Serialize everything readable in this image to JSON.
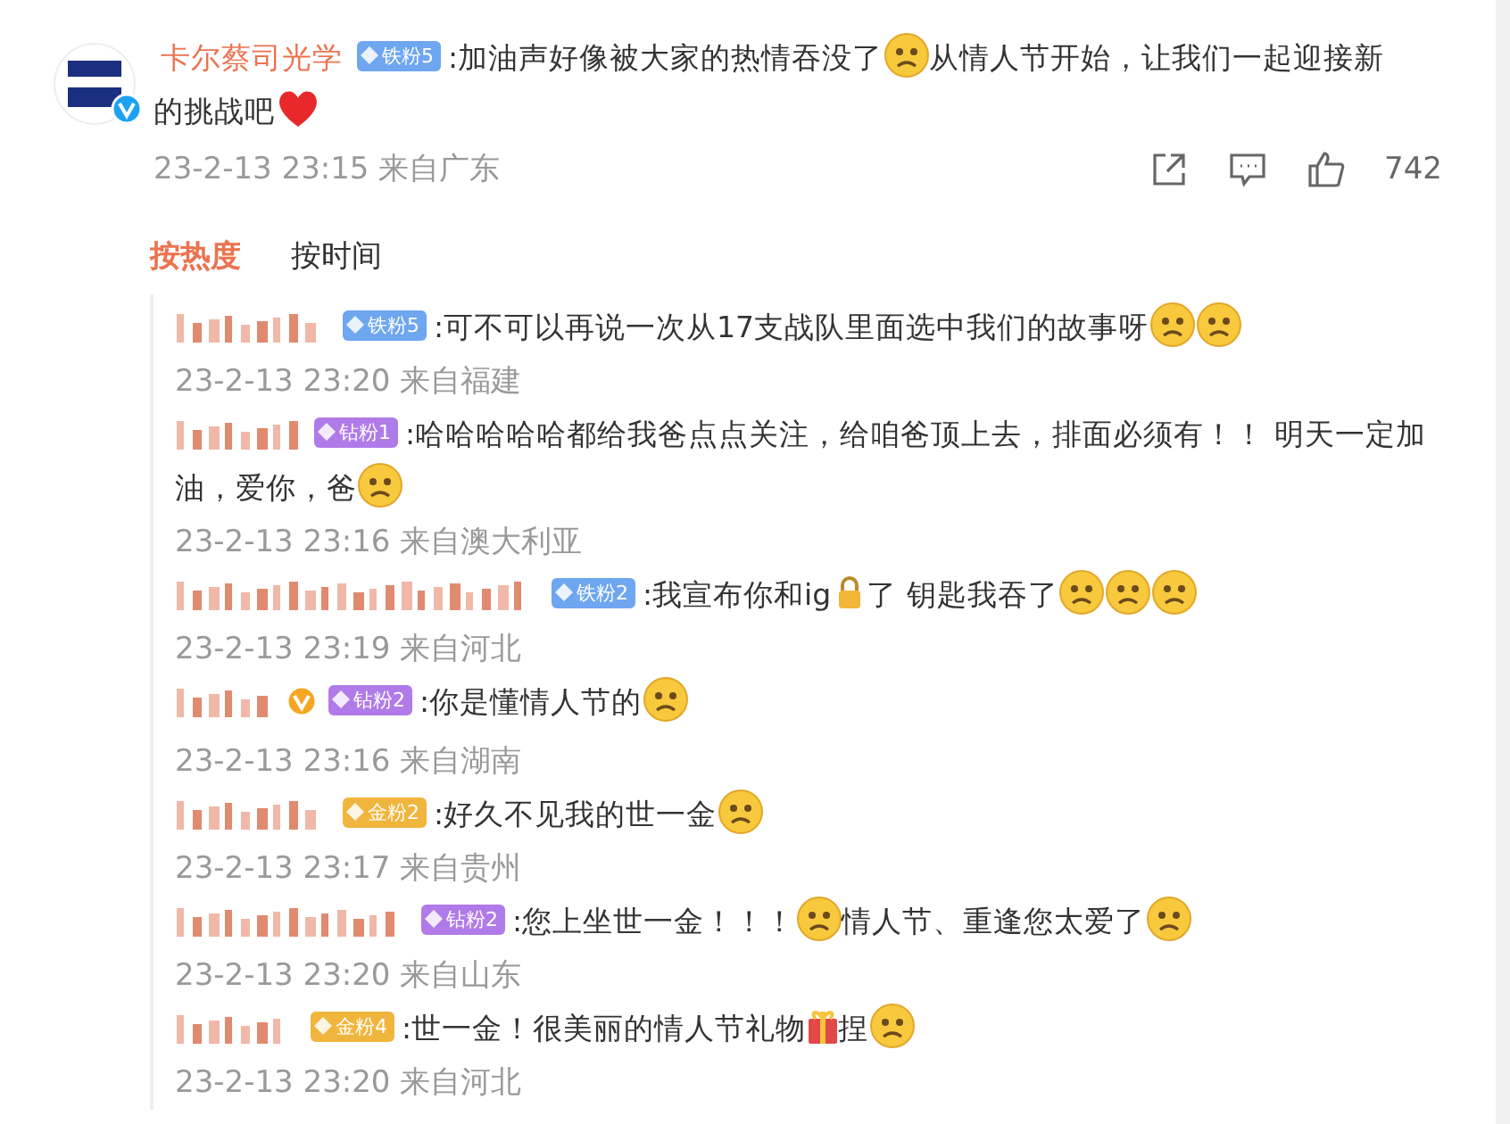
{
  "post": {
    "author": "卡尔蔡司光学",
    "verified": true,
    "badge": {
      "kind": "iron",
      "label": "铁粉5"
    },
    "content": [
      {
        "kind": "text",
        "text": ":加油声好像被大家的热情吞没了"
      },
      {
        "kind": "face"
      },
      {
        "kind": "text",
        "text": "从情人节开始，让我们一起迎接新"
      },
      {
        "kind": "text",
        "text": "的挑战吧"
      },
      {
        "kind": "heart"
      }
    ],
    "meta": "23-2-13 23:15 来自广东",
    "likes": "742"
  },
  "sort_tabs": [
    {
      "label": "按热度",
      "selected": true
    },
    {
      "label": "按时间",
      "selected": false
    }
  ],
  "comments": [
    {
      "verified": false,
      "badge": {
        "kind": "iron",
        "label": "铁粉5"
      },
      "content": [
        {
          "kind": "text",
          "text": ":可不可以再说一次从17支战队里面选中我们的故事呀"
        },
        {
          "kind": "face"
        },
        {
          "kind": "face"
        }
      ],
      "meta": "23-2-13 23:20 来自福建"
    },
    {
      "verified": false,
      "badge": {
        "kind": "diamond",
        "label": "钻粉1"
      },
      "content": [
        {
          "kind": "text",
          "text": ":哈哈哈哈哈都给我爸点点关注，给咱爸顶上去，排面必须有！！ 明天一定加"
        },
        {
          "kind": "text",
          "text": "油，爱你，爸"
        },
        {
          "kind": "face"
        }
      ],
      "meta": "23-2-13 23:16 来自澳大利亚"
    },
    {
      "verified": false,
      "badge": {
        "kind": "iron",
        "label": "铁粉2"
      },
      "content": [
        {
          "kind": "text",
          "text": ":我宣布你和ig"
        },
        {
          "kind": "lock"
        },
        {
          "kind": "text",
          "text": "了 钥匙我吞了"
        },
        {
          "kind": "face"
        },
        {
          "kind": "face"
        },
        {
          "kind": "face"
        }
      ],
      "meta": "23-2-13 23:19 来自河北"
    },
    {
      "verified": true,
      "badge": {
        "kind": "diamond",
        "label": "钻粉2"
      },
      "content": [
        {
          "kind": "text",
          "text": ":你是懂情人节的"
        },
        {
          "kind": "face"
        }
      ],
      "meta": "23-2-13 23:16 来自湖南"
    },
    {
      "verified": false,
      "badge": {
        "kind": "gold",
        "label": "金粉2"
      },
      "content": [
        {
          "kind": "text",
          "text": ":好久不见我的世一金"
        },
        {
          "kind": "face"
        }
      ],
      "meta": "23-2-13 23:17 来自贵州"
    },
    {
      "verified": false,
      "badge": {
        "kind": "diamond",
        "label": "钻粉2"
      },
      "content": [
        {
          "kind": "text",
          "text": ":您上坐世一金！！！"
        },
        {
          "kind": "face"
        },
        {
          "kind": "text",
          "text": "情人节、重逢您太爱了"
        },
        {
          "kind": "face"
        }
      ],
      "meta": "23-2-13 23:20 来自山东"
    },
    {
      "verified": false,
      "badge": {
        "kind": "gold",
        "label": "金粉4"
      },
      "content": [
        {
          "kind": "text",
          "text": ":世一金！很美丽的情人节礼物"
        },
        {
          "kind": "gift"
        },
        {
          "kind": "text",
          "text": "捏"
        },
        {
          "kind": "face"
        }
      ],
      "meta": "23-2-13 23:20 来自河北"
    }
  ]
}
